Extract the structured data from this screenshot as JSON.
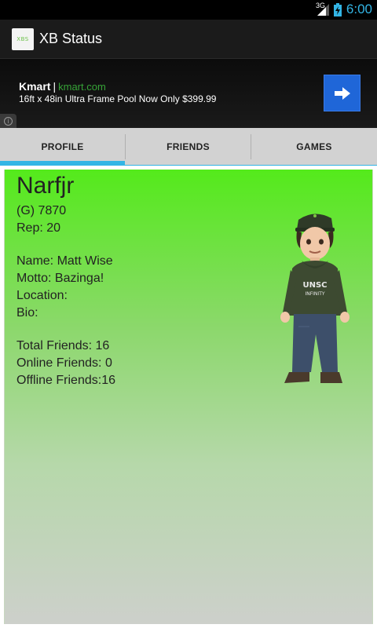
{
  "status_bar": {
    "network": "3G",
    "time": "6:00",
    "colors": {
      "accent": "#33b5e5"
    }
  },
  "action_bar": {
    "icon_label": "XBS",
    "title": "XB Status"
  },
  "ad": {
    "brand": "Kmart",
    "separator": "|",
    "url": "kmart.com",
    "text": "16ft x 48in Ultra Frame Pool Now Only $399.99",
    "button_icon": "arrow-right-icon",
    "info_glyph": "i"
  },
  "tabs": [
    {
      "label": "PROFILE",
      "selected": true
    },
    {
      "label": "FRIENDS",
      "selected": false
    },
    {
      "label": "GAMES",
      "selected": false
    }
  ],
  "profile": {
    "gamertag": "Narfjr",
    "gamerscore": "(G) 7870",
    "rep": "Rep: 20",
    "name": "Name: Matt Wise",
    "motto": "Motto: Bazinga!",
    "location": "Location:",
    "bio": "Bio:",
    "total_friends": "Total Friends: 16",
    "online_friends": "Online Friends: 0",
    "offline_friends": "Offline Friends:16",
    "avatar_shirt_text": [
      "UNSC",
      "INFINITY"
    ]
  }
}
